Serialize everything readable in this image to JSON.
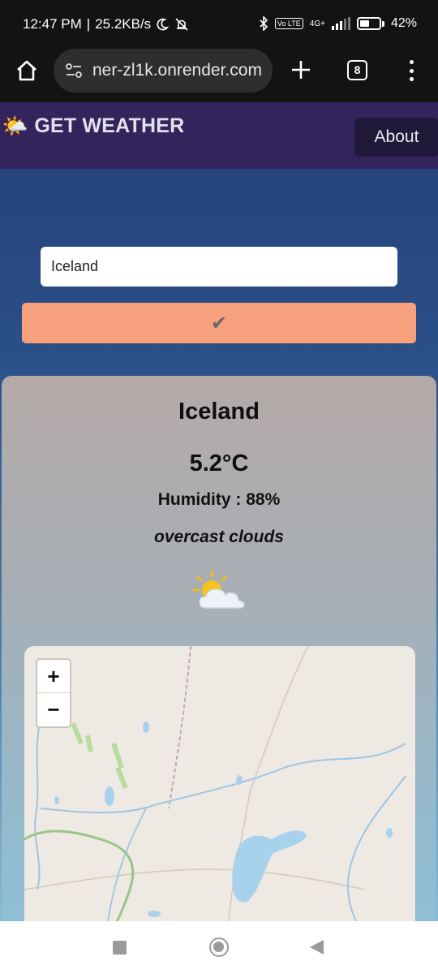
{
  "status_bar": {
    "time": "12:47 PM",
    "separator": "|",
    "net_speed": "25.2KB/s",
    "network": "4G+",
    "volte": "Vo LTE",
    "battery": "42%"
  },
  "browser": {
    "url": "ner-zl1k.onrender.com",
    "tab_count": "8"
  },
  "navbar": {
    "brand_emoji": "🌤️",
    "brand_text": "GET WEATHER",
    "about_label": "About"
  },
  "search": {
    "value": "Iceland",
    "submit_label": "✔"
  },
  "weather": {
    "city": "Iceland",
    "temperature": "5.2°C",
    "humidity": "Humidity : 88%",
    "description": "overcast clouds",
    "icon": "sun-behind-cloud-icon"
  },
  "map": {
    "zoom_in_label": "+",
    "zoom_out_label": "−"
  },
  "colors": {
    "navbar_bg": "#33245c",
    "about_bg": "#211939",
    "submit_bg": "#f6a07e",
    "page_gradient_top": "#243f7b",
    "map_land": "#efe9e3",
    "map_water": "#a8d2ec"
  }
}
